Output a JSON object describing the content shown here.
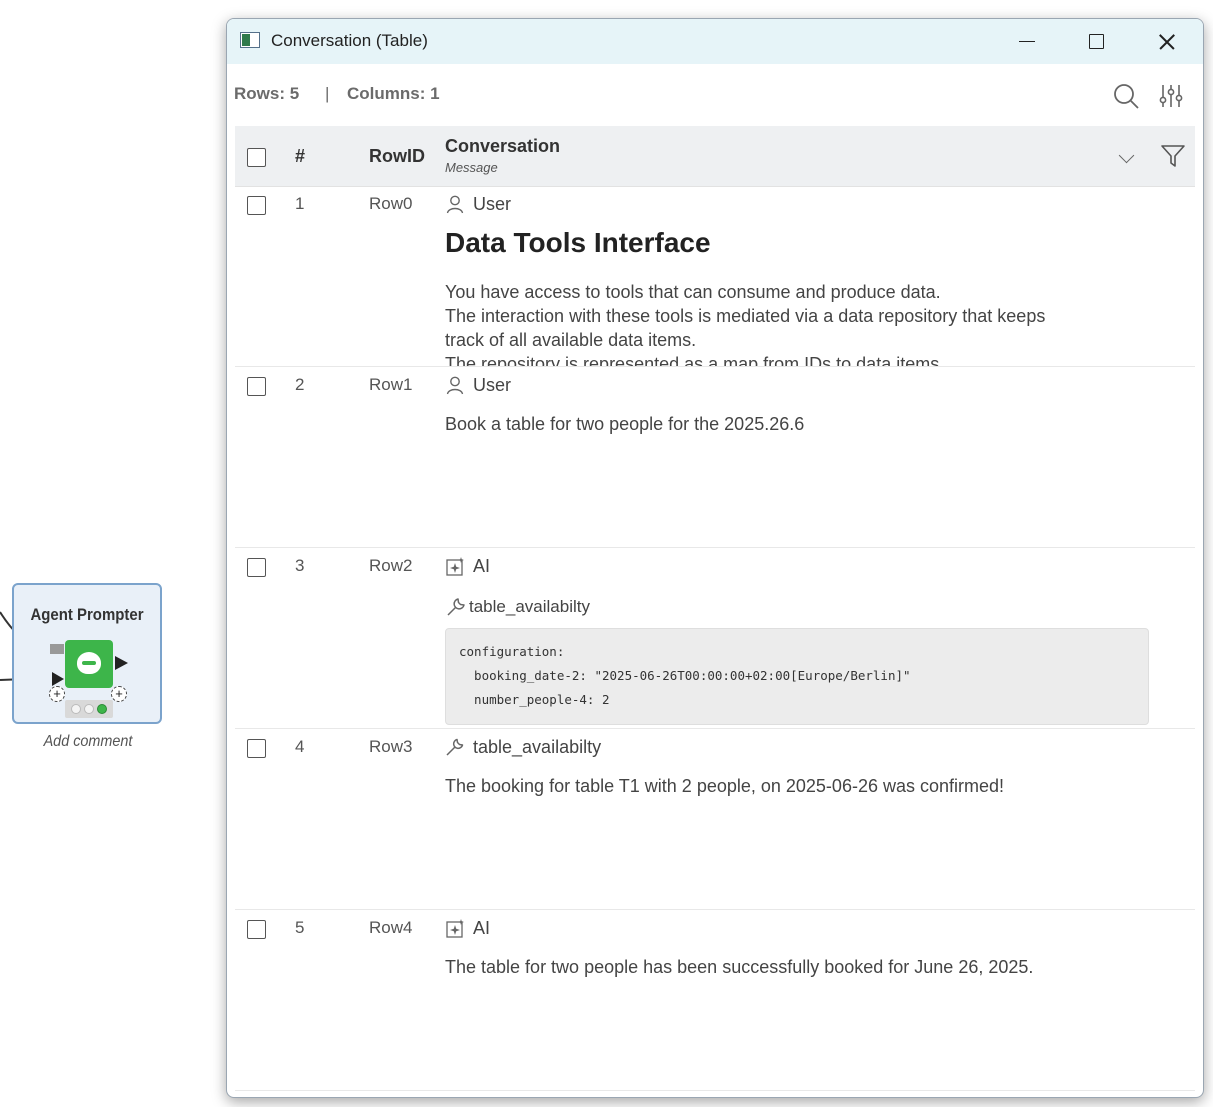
{
  "canvas": {
    "node": {
      "title": "Agent Prompter"
    },
    "comment": "Add comment"
  },
  "window": {
    "title": "Conversation (Table)"
  },
  "info": {
    "rows": "Rows: 5",
    "separator": "|",
    "columns": "Columns: 1"
  },
  "table": {
    "headers": {
      "index": "#",
      "rowid": "RowID",
      "column": "Conversation",
      "column_type": "Message"
    },
    "rows": [
      {
        "num": "1",
        "id": "Row0",
        "role": "User",
        "heading": "Data Tools Interface",
        "lines": [
          "You have access to tools that can consume and produce data.",
          "The interaction with these tools is mediated via a data repository that keeps",
          "track of all available data items.",
          "The repository is represented as a map from IDs to data items."
        ]
      },
      {
        "num": "2",
        "id": "Row1",
        "role": "User",
        "text": "Book a table for two people for the 2025.26.6"
      },
      {
        "num": "3",
        "id": "Row2",
        "role": "AI",
        "tool": "table_availabilty",
        "code": [
          "configuration:",
          "  booking_date-2: \"2025-06-26T00:00:00+02:00[Europe/Berlin]\"",
          "  number_people-4: 2"
        ]
      },
      {
        "num": "4",
        "id": "Row3",
        "role": "table_availabilty",
        "text": "The booking for table T1 with 2 people, on 2025-06-26 was confirmed!"
      },
      {
        "num": "5",
        "id": "Row4",
        "role": "AI",
        "text": "The table for two people has been successfully booked for June 26, 2025."
      }
    ]
  },
  "icons": {
    "user": "user-icon",
    "ai": "ai-sparkle-icon",
    "tool": "wrench-icon",
    "search": "search-icon",
    "settings": "sliders-icon",
    "filter": "filter-icon",
    "chevron": "chevron-down-icon"
  }
}
